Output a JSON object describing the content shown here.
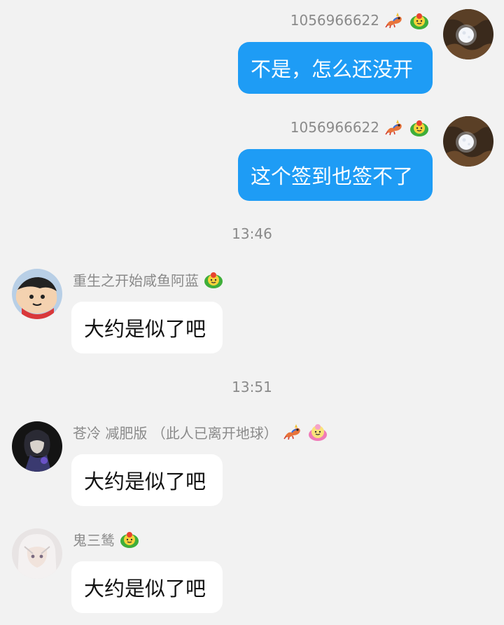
{
  "colors": {
    "background": "#f2f2f2",
    "outgoing_bubble": "#1e9cf5",
    "incoming_bubble": "#ffffff",
    "meta_text": "#8a8a8a"
  },
  "messages": [
    {
      "sender": "1056966622",
      "text": "不是，怎么还没开",
      "direction": "outgoing",
      "badges": [
        "dragon-badge-icon",
        "flower-badge-icon"
      ]
    },
    {
      "sender": "1056966622",
      "text": "这个签到也签不了",
      "direction": "outgoing",
      "badges": [
        "dragon-badge-icon",
        "flower-badge-icon"
      ]
    },
    {
      "timestamp": "13:46"
    },
    {
      "sender": "重生之开始咸鱼阿蓝",
      "text": "大约是似了吧",
      "direction": "incoming",
      "badges": [
        "flower-badge-icon"
      ]
    },
    {
      "timestamp": "13:51"
    },
    {
      "sender": "苍冷 减肥版 （此人已离开地球）",
      "text": "大约是似了吧",
      "direction": "incoming",
      "badges": [
        "dragon-badge-icon",
        "flower-pink-badge-icon"
      ]
    },
    {
      "sender": "鬼三鸶",
      "text": "大约是似了吧",
      "direction": "incoming",
      "badges": [
        "flower-badge-icon"
      ]
    }
  ]
}
